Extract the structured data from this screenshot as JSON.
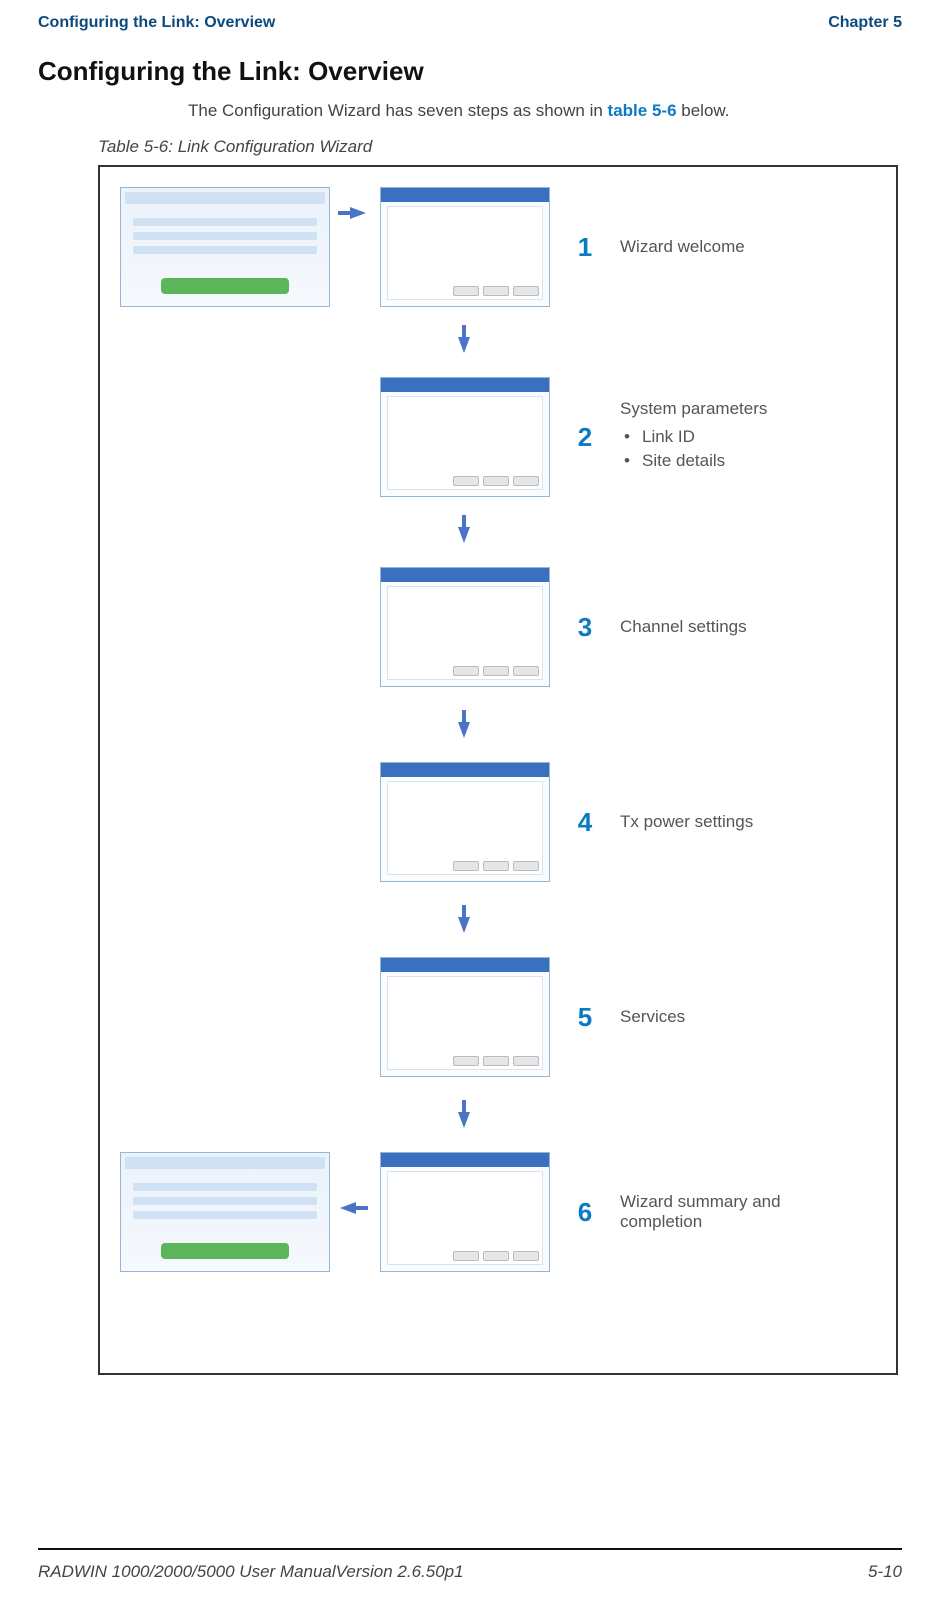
{
  "header": {
    "running_head": "Configuring the Link: Overview",
    "chapter": "Chapter 5"
  },
  "section": {
    "title": "Configuring the Link: Overview",
    "intro_pre": "The Configuration Wizard has seven steps as shown in ",
    "intro_ref": "table 5-6",
    "intro_post": " below.",
    "table_caption": "Table 5-6: Link Configuration Wizard"
  },
  "steps": [
    {
      "num": "1",
      "label": "Wizard welcome"
    },
    {
      "num": "2",
      "label": "System parameters",
      "bullets": [
        "Link ID",
        "Site details"
      ]
    },
    {
      "num": "3",
      "label": "Channel settings"
    },
    {
      "num": "4",
      "label": "Tx power settings"
    },
    {
      "num": "5",
      "label": "Services"
    },
    {
      "num": "6",
      "label": "Wizard summary and completion"
    }
  ],
  "footer": {
    "left": "RADWIN 1000/2000/5000 User ManualVersion  2.6.50p1",
    "right": "5-10"
  }
}
